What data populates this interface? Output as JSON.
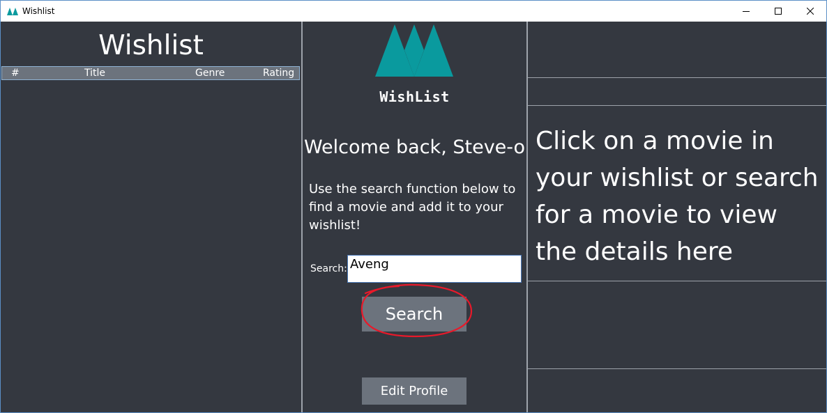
{
  "window": {
    "title": "Wishlist",
    "controls": [
      "minimize-icon",
      "maximize-icon",
      "close-icon"
    ]
  },
  "left_panel": {
    "heading": "Wishlist",
    "table": {
      "columns": [
        "#",
        "Title",
        "Genre",
        "Rating"
      ],
      "rows": []
    }
  },
  "middle_panel": {
    "logo_text": "WishList",
    "welcome": "Welcome back, Steve-o",
    "instructions": "Use the search function below to find a movie and add it to your wishlist!",
    "search": {
      "label": "Search:",
      "value": "Aveng",
      "button_label": "Search"
    },
    "edit_profile_label": "Edit Profile"
  },
  "right_panel": {
    "placeholder": "Click on a movie in your wishlist or search for a movie to view the details here"
  },
  "colors": {
    "background": "#343840",
    "header_background": "#6c737d",
    "button": "#6c737d",
    "logo_teal": "#0a9a9e",
    "annotation_red": "#e8192a",
    "divider": "#9ea3ab"
  }
}
